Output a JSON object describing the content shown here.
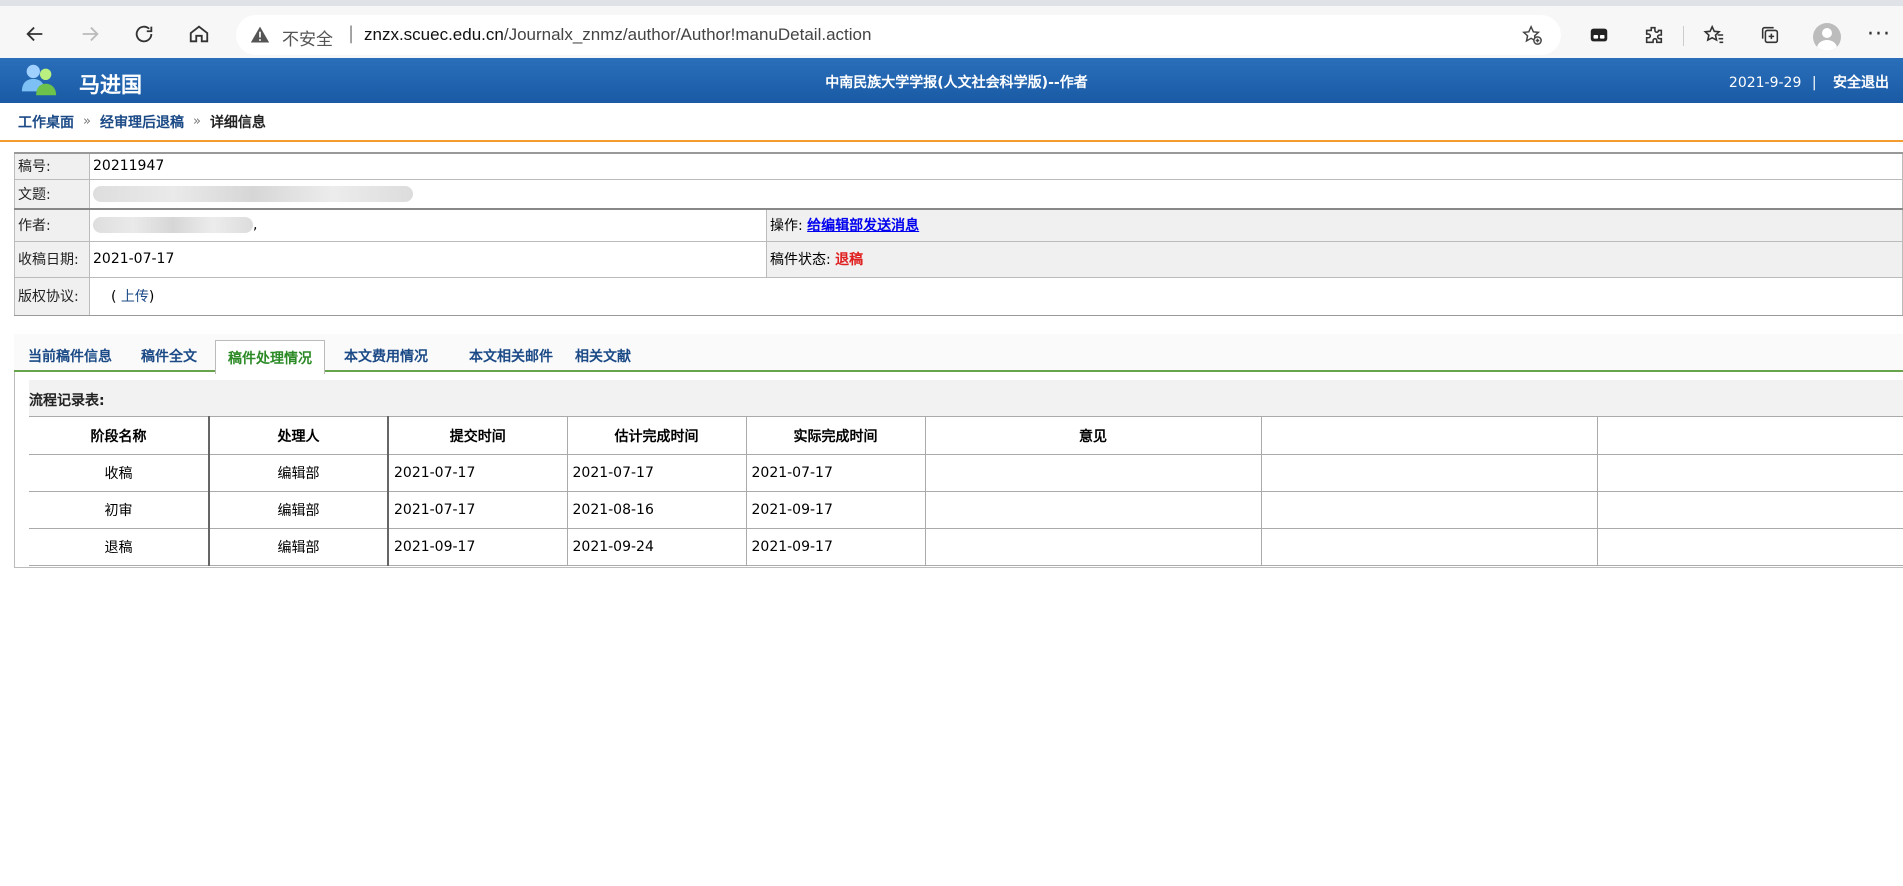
{
  "browser": {
    "insecure_label": "不安全",
    "url_domain": "znzx.scuec.edu.cn",
    "url_path": "/Journalx_znmz/author/Author!manuDetail.action"
  },
  "header": {
    "user_name": "马进国",
    "journal_title": "中南民族大学学报(人文社会科学版)--作者",
    "date": "2021-9-29",
    "separator": "|",
    "logout_label": "安全退出",
    "bar_color": "#1a5aa5"
  },
  "breadcrumb": {
    "items": [
      "工作桌面",
      "经审理后退稿"
    ],
    "separator": "»",
    "current": "详细信息"
  },
  "info": {
    "manuscript_no_label": "稿号:",
    "manuscript_no": "20211947",
    "title_label": "文题:",
    "title_visible_prefix": "",
    "author_label": "作者:",
    "author_suffix": ",",
    "operation_label": "操作:",
    "operation_link": "给编辑部发送消息",
    "received_label": "收稿日期:",
    "received_date": "2021-07-17",
    "status_label": "稿件状态:",
    "status_value": "退稿",
    "copyright_label": "版权协议:",
    "copyright_paren_open": "(",
    "copyright_upload": "上传",
    "copyright_paren_close": ")",
    "status_color": "#e02020"
  },
  "tabs": [
    {
      "label": "当前稿件信息",
      "active": false
    },
    {
      "label": "稿件全文",
      "active": false
    },
    {
      "label": "稿件处理情况",
      "active": true
    },
    {
      "label": "本文费用情况",
      "active": false
    },
    {
      "label": "本文相关邮件",
      "active": false
    },
    {
      "label": "相关文献",
      "active": false
    }
  ],
  "process": {
    "title": "流程记录表:",
    "columns": [
      "阶段名称",
      "处理人",
      "提交时间",
      "估计完成时间",
      "实际完成时间",
      "意见",
      "",
      ""
    ],
    "rows": [
      [
        "收稿",
        "编辑部",
        "2021-07-17",
        "2021-07-17",
        "2021-07-17",
        "",
        "",
        ""
      ],
      [
        "初审",
        "编辑部",
        "2021-07-17",
        "2021-08-16",
        "2021-09-17",
        "",
        "",
        ""
      ],
      [
        "退稿",
        "编辑部",
        "2021-09-17",
        "2021-09-24",
        "2021-09-17",
        "",
        "",
        ""
      ]
    ]
  },
  "icons": {
    "back": "back-arrow-icon",
    "forward": "forward-arrow-icon",
    "refresh": "refresh-icon",
    "home": "home-icon",
    "warning": "warning-icon",
    "favorite_add": "star-plus-icon",
    "reading": "immersive-reader-icon",
    "extensions": "puzzle-icon",
    "favorites": "favorites-icon",
    "collections": "collections-icon",
    "profile": "avatar",
    "more": "more-icon",
    "logo": "users-logo-icon"
  }
}
